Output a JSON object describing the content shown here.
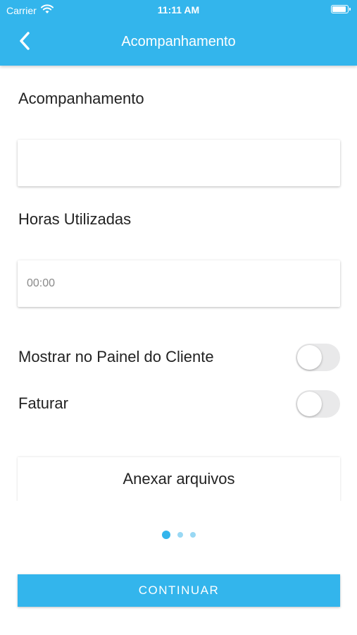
{
  "status_bar": {
    "carrier": "Carrier",
    "time": "11:11 AM",
    "battery_level": 1.0,
    "wifi_icon": "wifi-icon"
  },
  "header": {
    "title": "Acompanhamento",
    "back_icon": "chevron-left-icon",
    "background_color": "#33b5ec"
  },
  "form": {
    "acompanhamento": {
      "label": "Acompanhamento",
      "value": "",
      "placeholder": ""
    },
    "horas": {
      "label": "Horas Utilizadas",
      "value": "",
      "placeholder": "00:00"
    },
    "toggles": [
      {
        "label": "Mostrar no Painel do Cliente",
        "on": false
      },
      {
        "label": "Faturar",
        "on": false
      }
    ],
    "attach": {
      "label": "Anexar arquivos"
    }
  },
  "pager": {
    "pages": 3,
    "current": 1
  },
  "continue_button": {
    "label": "CONTINUAR"
  }
}
